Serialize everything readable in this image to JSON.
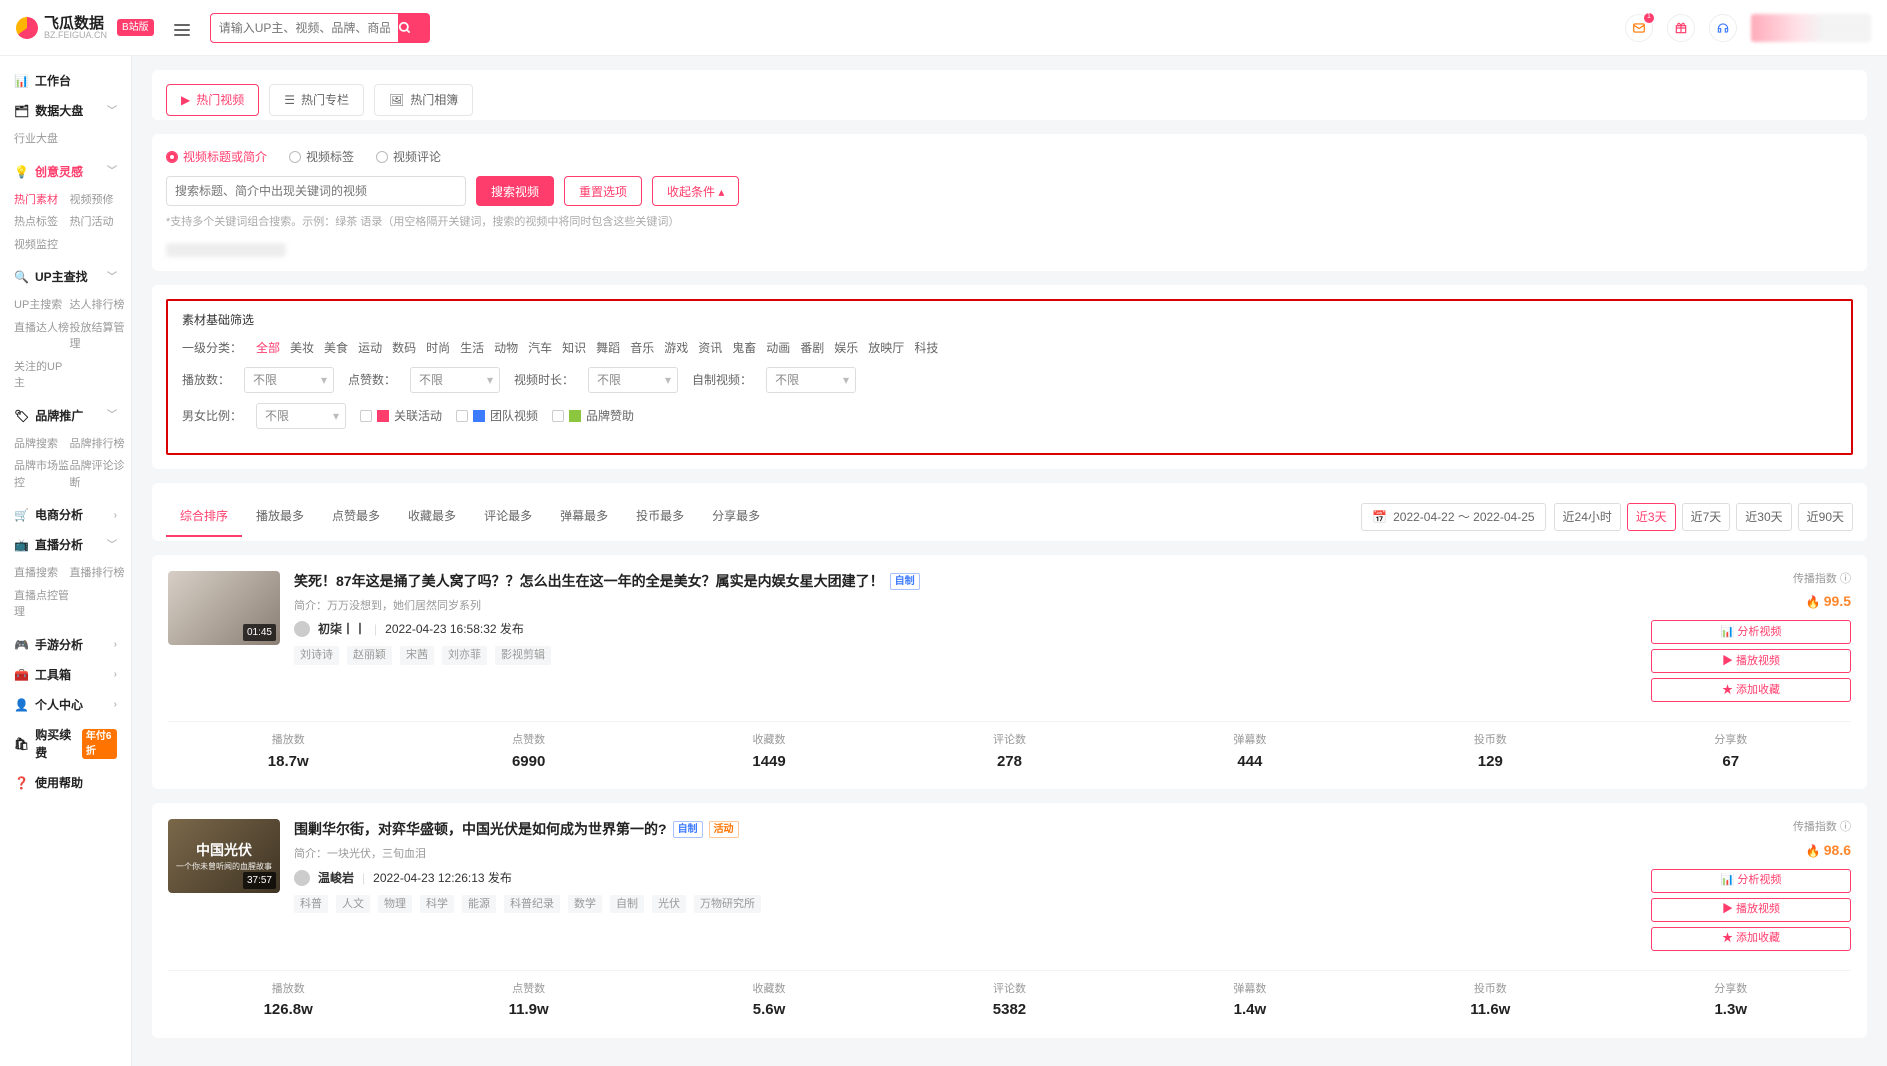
{
  "brand": {
    "name": "飞瓜数据",
    "sub": "BZ.FEIGUA.CN",
    "badge": "B站版"
  },
  "searchTop": {
    "placeholder": "请输入UP主、视频、品牌、商品关键词搜索"
  },
  "notif": {
    "count": "1"
  },
  "sidebar": {
    "workbench": "工作台",
    "bigboard": {
      "t": "数据大盘",
      "items": [
        "行业大盘"
      ]
    },
    "creative": {
      "t": "创意灵感",
      "items": [
        "热门素材",
        "视频预修",
        "热点标签",
        "热门活动",
        "视频监控"
      ]
    },
    "upsearch": {
      "t": "UP主查找",
      "items": [
        "UP主搜索",
        "达人排行榜",
        "直播达人榜",
        "投放结算管理",
        "关注的UP主"
      ]
    },
    "brandpromo": {
      "t": "品牌推广",
      "items": [
        "品牌搜索",
        "品牌排行榜",
        "品牌市场监控",
        "品牌评论诊断"
      ]
    },
    "ecom": "电商分析",
    "live": {
      "t": "直播分析",
      "items": [
        "直播搜索",
        "直播排行榜",
        "直播点控管理"
      ]
    },
    "mobile": "手游分析",
    "tools": "工具箱",
    "profile": "个人中心",
    "renew": {
      "t": "购买续费",
      "pill": "年付6折"
    },
    "help": "使用帮助"
  },
  "topTabs": [
    "热门视频",
    "热门专栏",
    "热门相簿"
  ],
  "radios": [
    "视频标题或简介",
    "视频标签",
    "视频评论"
  ],
  "searchBox": {
    "placeholder": "搜索标题、简介中出现关键词的视频",
    "btn": "搜索视频",
    "reset": "重置选项",
    "collapse": "收起条件"
  },
  "hint": "*支持多个关键词组合搜索。示例：绿茶 语录（用空格隔开关键词，搜索的视频中将同时包含这些关键词）",
  "filter": {
    "title": "素材基础筛选",
    "catLabel": "一级分类：",
    "cats": [
      "全部",
      "美妆",
      "美食",
      "运动",
      "数码",
      "时尚",
      "生活",
      "动物",
      "汽车",
      "知识",
      "舞蹈",
      "音乐",
      "游戏",
      "资讯",
      "鬼畜",
      "动画",
      "番剧",
      "娱乐",
      "放映厅",
      "科技"
    ],
    "playLabel": "播放数：",
    "likeLabel": "点赞数：",
    "durLabel": "视频时长：",
    "selfLabel": "自制视频：",
    "ratioLabel": "男女比例：",
    "unlimited": "不限",
    "chk1": "关联活动",
    "chk2": "团队视频",
    "chk3": "品牌赞助"
  },
  "sort": {
    "tabs": [
      "综合排序",
      "播放最多",
      "点赞最多",
      "收藏最多",
      "评论最多",
      "弹幕最多",
      "投币最多",
      "分享最多"
    ],
    "range": "2022-04-22 ～ 2022-04-25",
    "btns": [
      "近24小时",
      "近3天",
      "近7天",
      "近30天",
      "近90天"
    ]
  },
  "spreadLabel": "传播指数",
  "actions": {
    "analyze": "分析视频",
    "playback": "播放视频",
    "fav": "添加收藏"
  },
  "metricLabels": [
    "播放数",
    "点赞数",
    "收藏数",
    "评论数",
    "弹幕数",
    "投币数",
    "分享数"
  ],
  "videos": [
    {
      "title": "笑死！87年这是捅了美人窝了吗？？怎么出生在这一年的全是美女？属实是内娱女星大团建了！",
      "tags": [
        "自制"
      ],
      "sub": "简介：万万没想到，她们居然同岁系列",
      "up": "初柒丨丨",
      "time": "2022-04-23 16:58:32 发布",
      "len": "01:45",
      "vt": [
        "刘诗诗",
        "赵丽颖",
        "宋茜",
        "刘亦菲",
        "影视剪辑"
      ],
      "score": "99.5",
      "thumb": "linear-gradient(135deg,#d7cfc6,#8b7f74)",
      "m": [
        "18.7w",
        "6990",
        "1449",
        "278",
        "444",
        "129",
        "67"
      ]
    },
    {
      "title": "围剿华尔街，对弈华盛顿，中国光伏是如何成为世界第一的?",
      "tags": [
        "自制",
        "活动"
      ],
      "sub": "简介：一块光伏，三旬血泪",
      "up": "温峻岩",
      "time": "2022-04-23 12:26:13 发布",
      "len": "37:57",
      "vt": [
        "科普",
        "人文",
        "物理",
        "科学",
        "能源",
        "科普纪录",
        "数学",
        "自制",
        "光伏",
        "万物研究所"
      ],
      "thumbTitle": "中国光伏",
      "thumbSub": "一个你未曾听闻的血腥故事",
      "score": "98.6",
      "thumb": "linear-gradient(135deg,#7b684a,#3f3424)",
      "m": [
        "126.8w",
        "11.9w",
        "5.6w",
        "5382",
        "1.4w",
        "11.6w",
        "1.3w"
      ]
    }
  ]
}
